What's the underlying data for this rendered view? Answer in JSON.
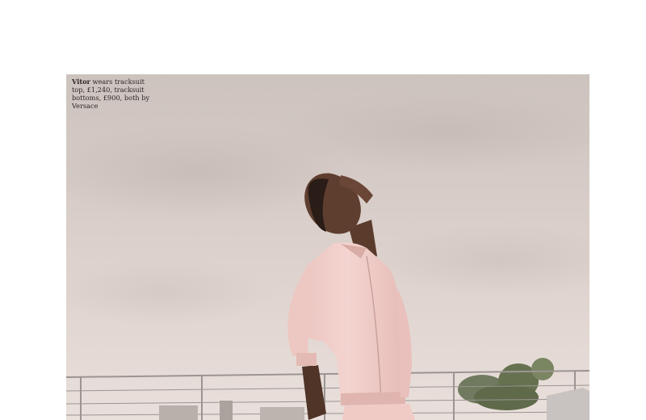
{
  "caption": {
    "name": "Vitor",
    "text": " wears tracksuit top, £1,240, tracksuit bottoms, £900, both by Versace"
  },
  "colors": {
    "sky_top": "#cfc5c0",
    "sky_bottom": "#e7dcd7",
    "tracksuit": "#f1cdc9",
    "skin": "#5a3b2c",
    "railing": "#9b9592"
  }
}
